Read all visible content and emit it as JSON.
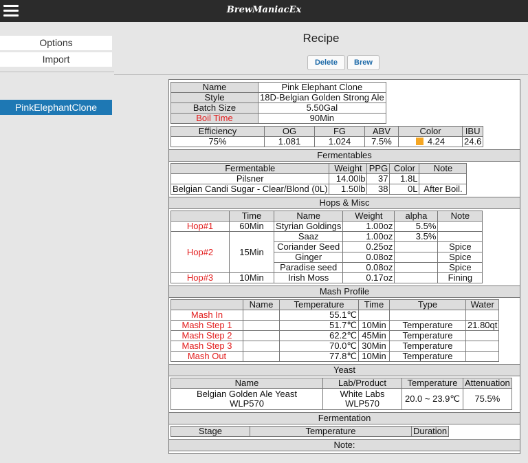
{
  "app_title": "BrewManiacEx",
  "sidebar": {
    "options_label": "Options",
    "import_label": "Import",
    "recipes": [
      "PinkElephantClone"
    ]
  },
  "page_title": "Recipe",
  "buttons": {
    "delete": "Delete",
    "brew": "Brew"
  },
  "info": {
    "labels": {
      "name": "Name",
      "style": "Style",
      "batch": "Batch Size",
      "boil": "Boil Time"
    },
    "name": "Pink Elephant Clone",
    "style": "18D-Belgian Golden Strong Ale",
    "batch": "5.50Gal",
    "boil": "90Min"
  },
  "stats": {
    "headers": [
      "Efficiency",
      "OG",
      "FG",
      "ABV",
      "Color",
      "IBU"
    ],
    "values": [
      "75%",
      "1.081",
      "1.024",
      "7.5%",
      "4.24",
      "24.6"
    ],
    "color_swatch": "#f5a623"
  },
  "fermentables": {
    "title": "Fermentables",
    "headers": [
      "Fermentable",
      "Weight",
      "PPG",
      "Color",
      "Note"
    ],
    "rows": [
      [
        "Pilsner",
        "14.00lb",
        "37",
        "1.8L",
        ""
      ],
      [
        "Belgian Candi Sugar - Clear/Blond (0L)",
        "1.50lb",
        "38",
        "0L",
        "After Boil."
      ]
    ]
  },
  "hops": {
    "title": "Hops & Misc",
    "headers": [
      "Time",
      "Name",
      "Weight",
      "alpha",
      "Note"
    ],
    "hop1": {
      "label": "Hop#1",
      "time": "60Min",
      "name": "Styrian Goldings",
      "weight": "1.00oz",
      "alpha": "5.5%",
      "note": ""
    },
    "hop2": {
      "label": "Hop#2",
      "time": "15Min",
      "items": [
        {
          "name": "Saaz",
          "weight": "1.00oz",
          "alpha": "3.5%",
          "note": ""
        },
        {
          "name": "Coriander Seed",
          "weight": "0.25oz",
          "alpha": "",
          "note": "Spice"
        },
        {
          "name": "Ginger",
          "weight": "0.08oz",
          "alpha": "",
          "note": "Spice"
        },
        {
          "name": "Paradise seed",
          "weight": "0.08oz",
          "alpha": "",
          "note": "Spice"
        }
      ]
    },
    "hop3": {
      "label": "Hop#3",
      "time": "10Min",
      "name": "Irish Moss",
      "weight": "0.17oz",
      "alpha": "",
      "note": "Fining"
    }
  },
  "mash": {
    "title": "Mash Profile",
    "headers": [
      "Name",
      "Temperature",
      "Time",
      "Type",
      "Water"
    ],
    "rows": [
      {
        "step": "Mash In",
        "name": "",
        "temp": "55.1℃",
        "time": "",
        "type": "",
        "water": ""
      },
      {
        "step": "Mash Step 1",
        "name": "",
        "temp": "51.7℃",
        "time": "10Min",
        "type": "Temperature",
        "water": "21.80qt"
      },
      {
        "step": "Mash Step 2",
        "name": "",
        "temp": "62.2℃",
        "time": "45Min",
        "type": "Temperature",
        "water": ""
      },
      {
        "step": "Mash Step 3",
        "name": "",
        "temp": "70.0℃",
        "time": "30Min",
        "type": "Temperature",
        "water": ""
      },
      {
        "step": "Mash Out",
        "name": "",
        "temp": "77.8℃",
        "time": "10Min",
        "type": "Temperature",
        "water": ""
      }
    ]
  },
  "yeast": {
    "title": "Yeast",
    "headers": [
      "Name",
      "Lab/Product",
      "Temperature",
      "Attenuation"
    ],
    "name_line1": "Belgian Golden Ale Yeast",
    "name_line2": "WLP570",
    "lab_line1": "White Labs",
    "lab_line2": "WLP570",
    "temperature": "20.0 ~ 23.9℃",
    "attenuation": "75.5%"
  },
  "fermentation": {
    "title": "Fermentation",
    "headers": [
      "Stage",
      "Temperature",
      "Duration"
    ]
  },
  "note_label": "Note:"
}
